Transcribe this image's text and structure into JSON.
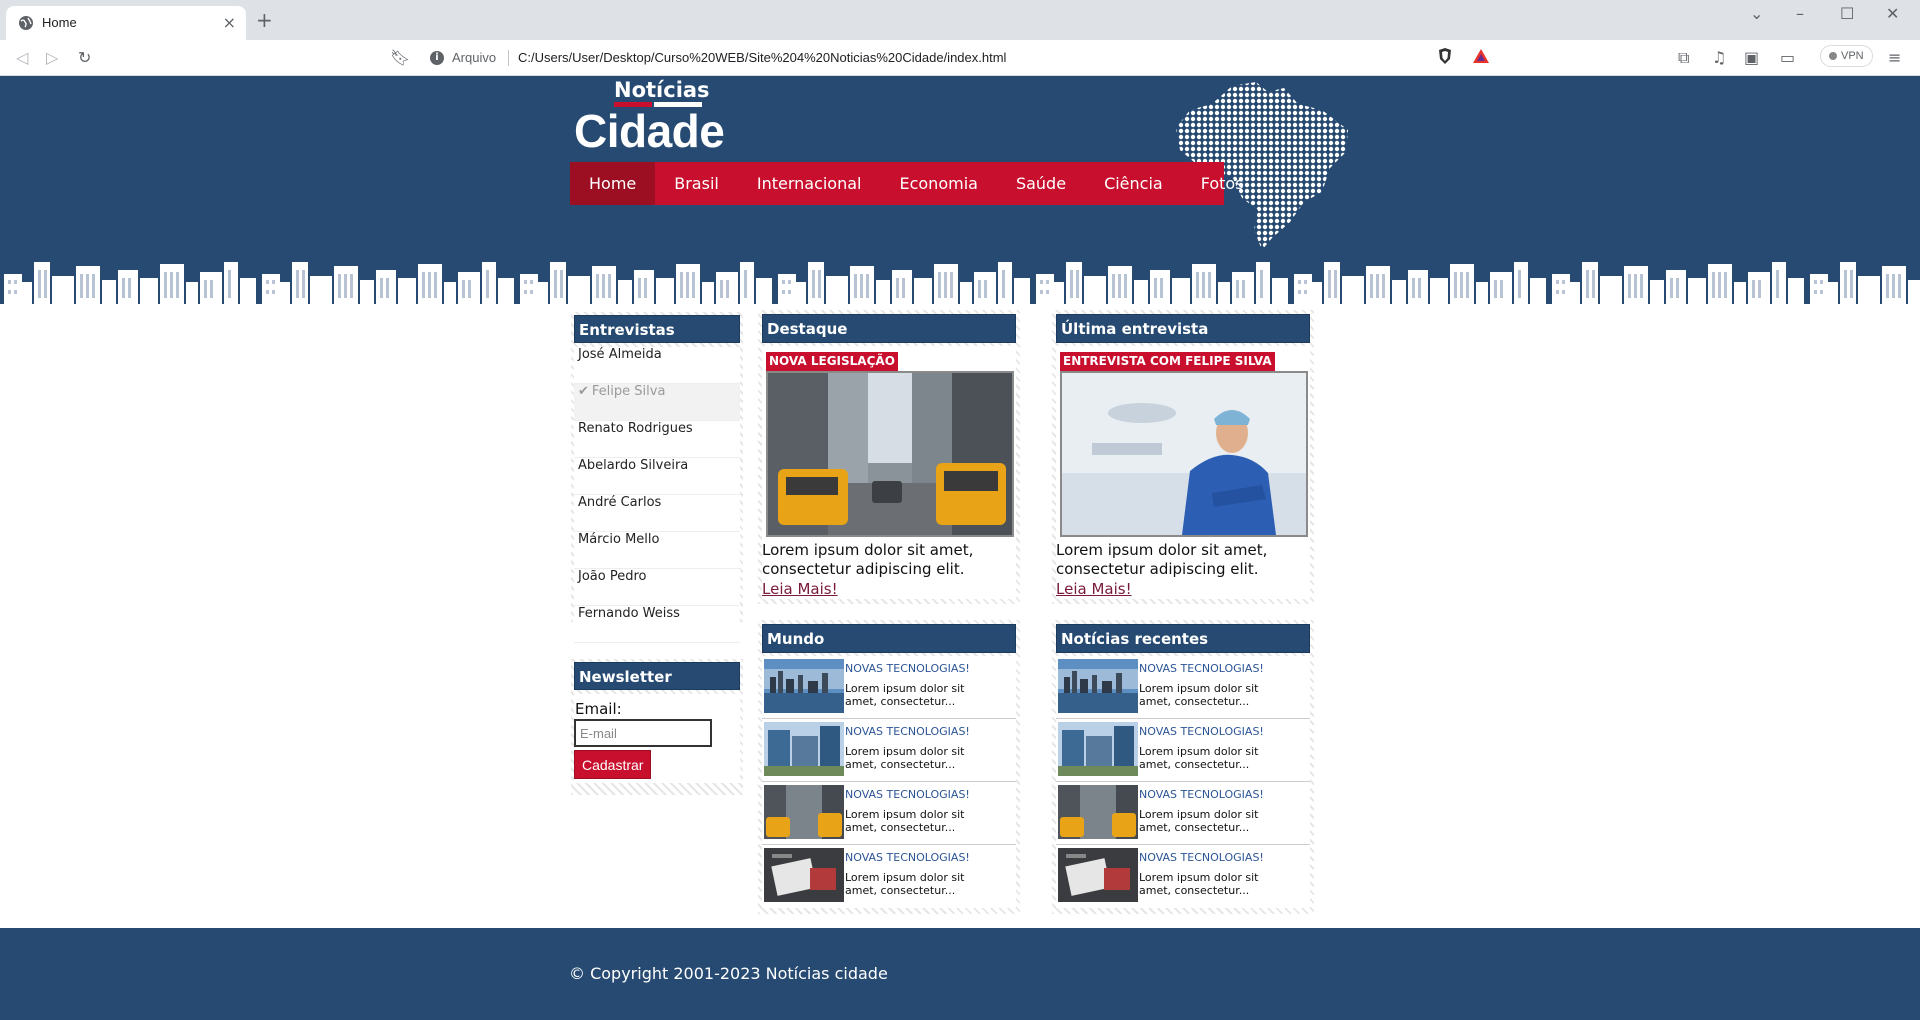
{
  "browser": {
    "tab_title": "Home",
    "url_label": "Arquivo",
    "url": "C:/Users/User/Desktop/Curso%20WEB/Site%204%20Noticias%20Cidade/index.html",
    "vpn_label": "VPN"
  },
  "logo": {
    "top": "Notícias",
    "main": "Cidade"
  },
  "nav": [
    "Home",
    "Brasil",
    "Internacional",
    "Economia",
    "Saúde",
    "Ciência",
    "Fotos"
  ],
  "entrevistas": {
    "title": "Entrevistas",
    "items": [
      "José Almeida",
      "Felipe Silva",
      "Renato Rodrigues",
      "Abelardo Silveira",
      "André Carlos",
      "Márcio Mello",
      "João Pedro",
      "Fernando Weiss"
    ],
    "selected": "Felipe Silva"
  },
  "newsletter": {
    "title": "Newsletter",
    "email_label": "Email:",
    "email_placeholder": "E-mail",
    "button": "Cadastrar"
  },
  "destaque": {
    "title": "Destaque",
    "tag": "NOVA LEGISLAÇÃO",
    "text": "Lorem ipsum dolor sit amet, consectetur adipiscing elit.",
    "link": "Leia Mais!"
  },
  "ultima": {
    "title": "Última entrevista",
    "tag": "ENTREVISTA COM FELIPE SILVA",
    "text": "Lorem ipsum dolor sit amet, consectetur adipiscing elit.",
    "link": "Leia Mais!"
  },
  "mundo": {
    "title": "Mundo",
    "items": [
      {
        "title": "NOVAS TECNOLOGIAS!",
        "desc": "Lorem ipsum dolor sit amet, consectetur..."
      },
      {
        "title": "NOVAS TECNOLOGIAS!",
        "desc": "Lorem ipsum dolor sit amet, consectetur..."
      },
      {
        "title": "NOVAS TECNOLOGIAS!",
        "desc": "Lorem ipsum dolor sit amet, consectetur..."
      },
      {
        "title": "NOVAS TECNOLOGIAS!",
        "desc": "Lorem ipsum dolor sit amet, consectetur..."
      }
    ]
  },
  "recentes": {
    "title": "Notícias recentes",
    "items": [
      {
        "title": "NOVAS TECNOLOGIAS!",
        "desc": "Lorem ipsum dolor sit amet, consectetur..."
      },
      {
        "title": "NOVAS TECNOLOGIAS!",
        "desc": "Lorem ipsum dolor sit amet, consectetur..."
      },
      {
        "title": "NOVAS TECNOLOGIAS!",
        "desc": "Lorem ipsum dolor sit amet, consectetur..."
      },
      {
        "title": "NOVAS TECNOLOGIAS!",
        "desc": "Lorem ipsum dolor sit amet, consectetur..."
      }
    ]
  },
  "footer": "© Copyright 2001-2023 Notícias cidade",
  "colors": {
    "navy": "#264a72",
    "red": "#c8102e",
    "dark_red": "#9c0f23"
  }
}
